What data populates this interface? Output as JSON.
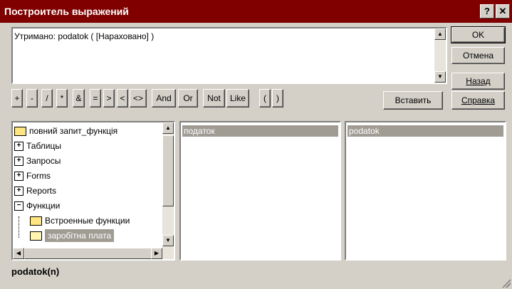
{
  "window": {
    "title": "Построитель выражений",
    "help_label": "?",
    "close_label": "✕"
  },
  "expression": {
    "text": "Утримано:  podatok ( [Нараховано] )"
  },
  "buttons": {
    "ok": "OK",
    "cancel": "Отмена",
    "back": "Назад",
    "help": "Справка",
    "insert": "Вставить"
  },
  "operators": [
    "+",
    "-",
    "/",
    "*",
    "&",
    "=",
    ">",
    "<",
    "<>",
    "And",
    "Or",
    "Not",
    "Like",
    "(",
    ")"
  ],
  "tree": {
    "items": [
      {
        "label": "повний запит_функція",
        "icon": "folder-icon"
      },
      {
        "label": "Таблицы",
        "icon": "expand-plus-icon"
      },
      {
        "label": "Запросы",
        "icon": "expand-plus-icon"
      },
      {
        "label": "Forms",
        "icon": "expand-plus-icon"
      },
      {
        "label": "Reports",
        "icon": "expand-plus-icon"
      },
      {
        "label": "Функции",
        "icon": "expand-minus-icon"
      },
      {
        "label": "Встроенные функции",
        "icon": "folder-icon"
      },
      {
        "label": "заробітна плата",
        "icon": "open-folder-icon"
      }
    ]
  },
  "middle_list": {
    "items": [
      "податок"
    ]
  },
  "right_list": {
    "items": [
      "podatok"
    ]
  },
  "status": {
    "text": "podatok(n)"
  }
}
